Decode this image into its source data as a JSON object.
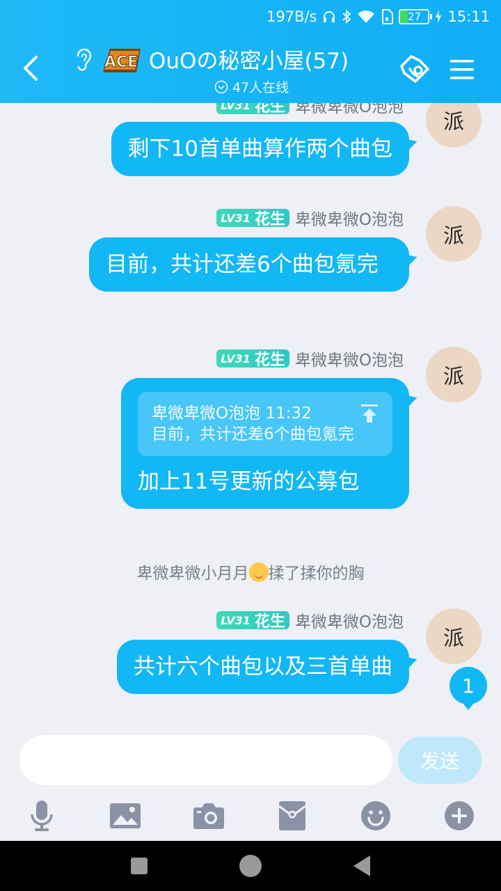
{
  "status_bar": {
    "speed": "197B/s",
    "battery": "27",
    "time": "15:11"
  },
  "header": {
    "title": "OuOの秘密小屋(57)",
    "online": "47人在线"
  },
  "messages": [
    {
      "level": "LV31",
      "nickname": "花生",
      "sender": "卑微卑微O泡泡",
      "text": "剩下10首单曲算作两个曲包",
      "avatar_char": "派"
    },
    {
      "level": "LV31",
      "nickname": "花生",
      "sender": "卑微卑微O泡泡",
      "text": "目前，共计还差6个曲包氪完",
      "avatar_char": "派"
    },
    {
      "level": "LV31",
      "nickname": "花生",
      "sender": "卑微卑微O泡泡",
      "quote_header": "卑微卑微O泡泡 11:32",
      "quote_text": "目前，共计还差6个曲包氪完",
      "text": "加上11号更新的公募包",
      "avatar_char": "派"
    },
    {
      "level": "LV31",
      "nickname": "花生",
      "sender": "卑微卑微O泡泡",
      "text": "共计六个曲包以及三首单曲",
      "avatar_char": "派"
    }
  ],
  "system_message": {
    "actor": "卑微卑微小月月",
    "action": "揉了揉你的胸"
  },
  "unread_count": "1",
  "input": {
    "value": "",
    "send_label": "发送"
  },
  "colors": {
    "brand": "#12b7f5",
    "send_disabled": "#bfe9fb"
  }
}
